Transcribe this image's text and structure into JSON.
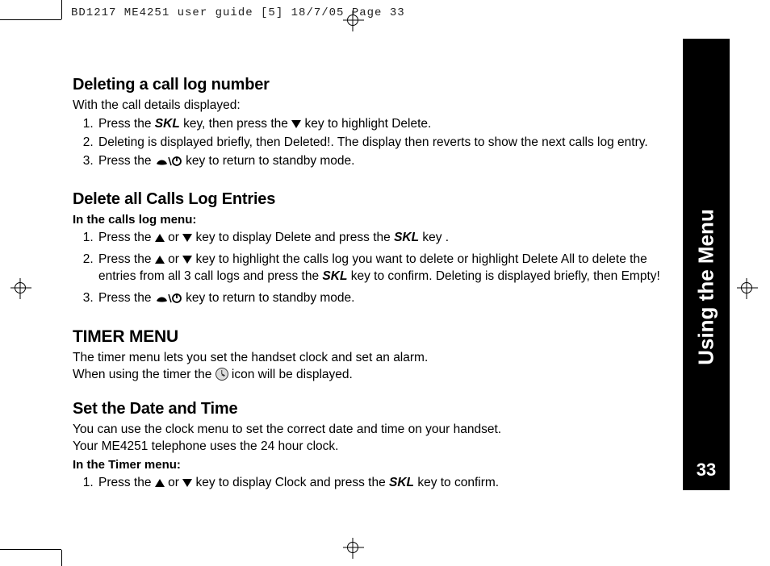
{
  "header": "BD1217 ME4251 user guide [5]  18/7/05    Page 33",
  "sidebar": {
    "label": "Using the Menu",
    "page": "33"
  },
  "icons": {
    "up": "up-triangle-icon",
    "down": "down-triangle-icon",
    "phone_power": "end-call-power-icon",
    "clock": "clock-icon"
  },
  "keys": {
    "skl": "SKL"
  },
  "sections": {
    "delete_call": {
      "title": "Deleting a call log number",
      "intro": "With the call details displayed:",
      "steps": [
        {
          "pre": "Press the ",
          "skl": true,
          "mid1": " key, then press the ",
          "sym1": "down",
          "mid2": " key to highlight Delete."
        },
        {
          "text": "Deleting is displayed briefly, then Deleted!. The display then reverts to show the next calls log entry."
        },
        {
          "pre": "Press the ",
          "sym1": "phone_power",
          "mid2": " key to return to standby mode."
        }
      ]
    },
    "delete_all": {
      "title": "Delete all Calls Log Entries",
      "sub": "In the calls log menu:",
      "steps": [
        {
          "pre": "Press the ",
          "sym1": "up",
          "mid1": " or ",
          "sym2": "down",
          "mid2": " key to display Delete and press the ",
          "skl_tail": true,
          "post": " key  ."
        },
        {
          "pre": "Press the ",
          "sym1": "up",
          "mid1": " or ",
          "sym2": "down",
          "mid2": " key to highlight the calls log you want to delete or highlight Delete All to delete the entries from all 3 call logs and press the ",
          "skl_tail": true,
          "post": " key to confirm. Deleting is displayed briefly, then Empty!"
        },
        {
          "pre": "Press the ",
          "sym1": "phone_power",
          "mid2": " key to return to standby mode."
        }
      ]
    },
    "timer": {
      "title": "TIMER MENU",
      "line1_pre": "The timer menu lets you set the handset clock and set an alarm.",
      "line2_pre": "When using the timer the ",
      "line2_post": " icon will be displayed."
    },
    "set_date": {
      "title": "Set the Date and Time",
      "line1": "You can use the clock menu to set the correct date and time on your handset.",
      "line2": "Your ME4251 telephone uses the 24 hour clock.",
      "sub": "In the Timer menu:",
      "steps": [
        {
          "pre": "Press the ",
          "sym1": "up",
          "mid1": " or ",
          "sym2": "down",
          "mid2": " key to display Clock and press the ",
          "skl_tail": true,
          "post": " key to confirm."
        }
      ]
    }
  }
}
